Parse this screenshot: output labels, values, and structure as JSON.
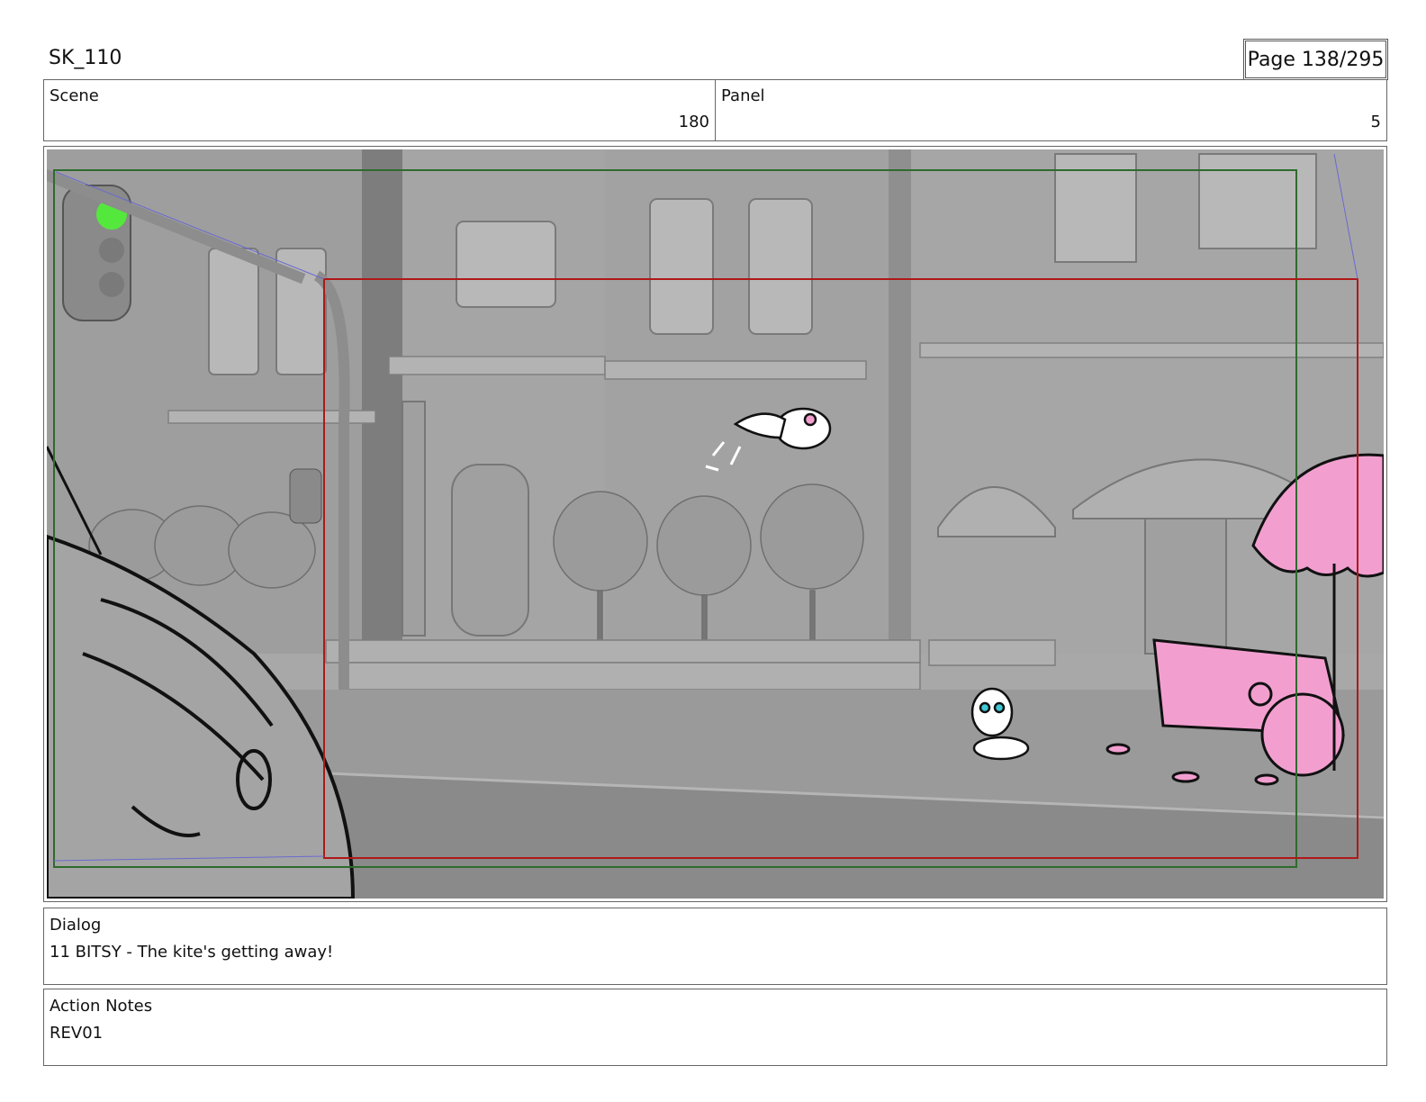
{
  "document": {
    "title": "SK_110",
    "page": "Page 138/295"
  },
  "header": {
    "scene_label": "Scene",
    "scene_value": "180",
    "panel_label": "Panel",
    "panel_value": "5"
  },
  "dialog": {
    "label": "Dialog",
    "text": "11 BITSY - The kite's getting away!"
  },
  "action_notes": {
    "label": "Action Notes",
    "text": "REV01"
  },
  "colors": {
    "safe_frame": "#2e6b2e",
    "camera_frame": "#b01818",
    "character_pink": "#f29fd0",
    "signal_green": "#55e83c",
    "background_gray": "#a9a9a9"
  }
}
